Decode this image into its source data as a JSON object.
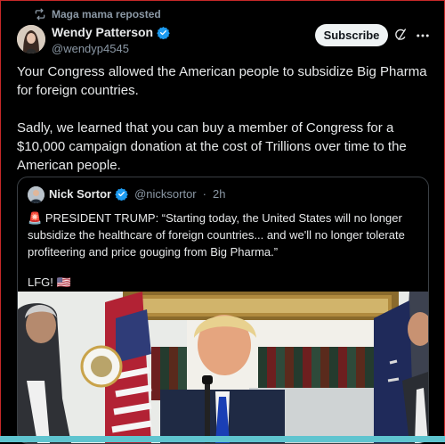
{
  "repost": {
    "text": "Maga mama reposted",
    "icon": "repost-icon"
  },
  "post": {
    "author_name": "Wendy Patterson",
    "author_handle": "@wendyp4545",
    "subscribe_label": "Subscribe",
    "paragraph1": "Your Congress allowed the American people to subsidize Big Pharma for foreign countries.",
    "paragraph2": "Sadly, we learned that you can buy a member of Congress for a $10,000 campaign donation at the cost of Trillions over time to the American people."
  },
  "quote": {
    "author_name": "Nick Sortor",
    "author_handle": "@nicksortor",
    "separator": "·",
    "time": "2h",
    "emoji_siren": "🚨",
    "text1": "PRESIDENT TRUMP: “Starting today, the United States will no longer subsidize the healthcare of foreign countries... and we'll no longer tolerate profiteering and price gouging from Big Pharma.”",
    "text2": "LFG!",
    "emoji_flag": "🇺🇸"
  },
  "colors": {
    "background": "#000000",
    "verified": "#1d9bf0",
    "accent_bar": "#5fc4cf",
    "border": "#c62828"
  }
}
